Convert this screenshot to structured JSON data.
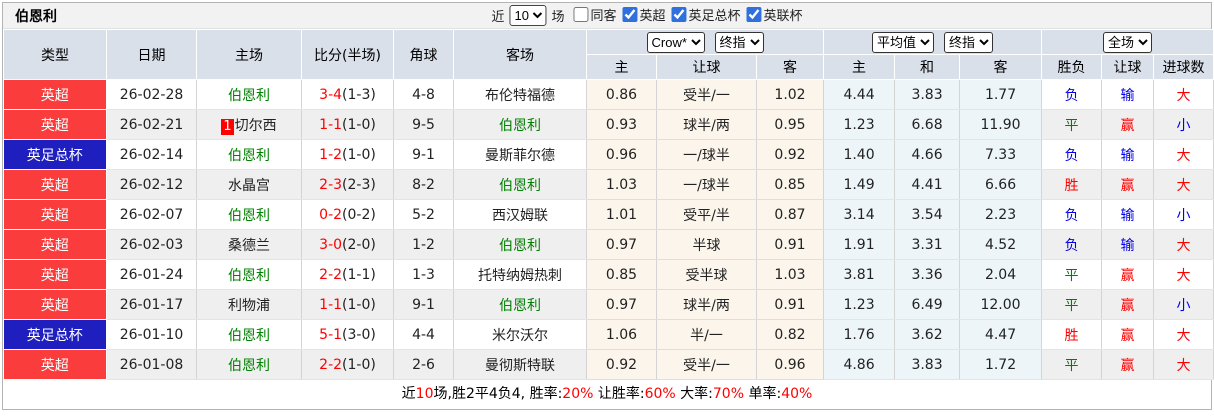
{
  "header": {
    "title": "伯恩利",
    "controls": {
      "near_label": "近",
      "matches_select": "10",
      "matches_label": "场",
      "checkboxes": [
        {
          "label": "同客",
          "checked": false
        },
        {
          "label": "英超",
          "checked": true
        },
        {
          "label": "英足总杯",
          "checked": true
        },
        {
          "label": "英联杯",
          "checked": true
        }
      ]
    }
  },
  "table": {
    "columns": [
      "类型",
      "日期",
      "主场",
      "比分(半场)",
      "角球",
      "客场"
    ],
    "dropdowns": {
      "odds_company": "Crow*",
      "odds_stage": "终指",
      "avg_type": "平均值",
      "avg_stage": "终指",
      "scope": "全场"
    },
    "sub_columns": [
      "主",
      "让球",
      "客",
      "主",
      "和",
      "客",
      "胜负",
      "让球",
      "进球数"
    ],
    "rows": [
      {
        "league": "英超",
        "league_color": "red",
        "date": "26-02-28",
        "home": "伯恩利",
        "home_self": true,
        "home_rank": "",
        "score": "3-4",
        "half": "(1-3)",
        "corner": "4-8",
        "away": "布伦特福德",
        "away_self": false,
        "odds": [
          "0.86",
          "受半/一",
          "1.02"
        ],
        "avg": [
          "4.44",
          "3.83",
          "1.77"
        ],
        "results": [
          "负",
          "输",
          "大"
        ]
      },
      {
        "league": "英超",
        "league_color": "red",
        "date": "26-02-21",
        "home": "切尔西",
        "home_self": false,
        "home_rank": "1",
        "score": "1-1",
        "half": "(1-0)",
        "corner": "9-5",
        "away": "伯恩利",
        "away_self": true,
        "odds": [
          "0.93",
          "球半/两",
          "0.95"
        ],
        "avg": [
          "1.23",
          "6.68",
          "11.90"
        ],
        "results": [
          "平",
          "赢",
          "小"
        ]
      },
      {
        "league": "英足总杯",
        "league_color": "blue",
        "date": "26-02-14",
        "home": "伯恩利",
        "home_self": true,
        "home_rank": "",
        "score": "1-2",
        "half": "(1-0)",
        "corner": "9-1",
        "away": "曼斯菲尔德",
        "away_self": false,
        "odds": [
          "0.96",
          "一/球半",
          "0.92"
        ],
        "avg": [
          "1.40",
          "4.66",
          "7.33"
        ],
        "results": [
          "负",
          "输",
          "大"
        ]
      },
      {
        "league": "英超",
        "league_color": "red",
        "date": "26-02-12",
        "home": "水晶宫",
        "home_self": false,
        "home_rank": "",
        "score": "2-3",
        "half": "(2-3)",
        "corner": "8-2",
        "away": "伯恩利",
        "away_self": true,
        "odds": [
          "1.03",
          "一/球半",
          "0.85"
        ],
        "avg": [
          "1.49",
          "4.41",
          "6.66"
        ],
        "results": [
          "胜",
          "赢",
          "大"
        ]
      },
      {
        "league": "英超",
        "league_color": "red",
        "date": "26-02-07",
        "home": "伯恩利",
        "home_self": true,
        "home_rank": "",
        "score": "0-2",
        "half": "(0-2)",
        "corner": "5-2",
        "away": "西汉姆联",
        "away_self": false,
        "odds": [
          "1.01",
          "受平/半",
          "0.87"
        ],
        "avg": [
          "3.14",
          "3.54",
          "2.23"
        ],
        "results": [
          "负",
          "输",
          "小"
        ]
      },
      {
        "league": "英超",
        "league_color": "red",
        "date": "26-02-03",
        "home": "桑德兰",
        "home_self": false,
        "home_rank": "",
        "score": "3-0",
        "half": "(2-0)",
        "corner": "1-2",
        "away": "伯恩利",
        "away_self": true,
        "odds": [
          "0.97",
          "半球",
          "0.91"
        ],
        "avg": [
          "1.91",
          "3.31",
          "4.52"
        ],
        "results": [
          "负",
          "输",
          "大"
        ]
      },
      {
        "league": "英超",
        "league_color": "red",
        "date": "26-01-24",
        "home": "伯恩利",
        "home_self": true,
        "home_rank": "",
        "score": "2-2",
        "half": "(1-1)",
        "corner": "1-3",
        "away": "托特纳姆热刺",
        "away_self": false,
        "odds": [
          "0.85",
          "受半球",
          "1.03"
        ],
        "avg": [
          "3.81",
          "3.36",
          "2.04"
        ],
        "results": [
          "平",
          "赢",
          "大"
        ]
      },
      {
        "league": "英超",
        "league_color": "red",
        "date": "26-01-17",
        "home": "利物浦",
        "home_self": false,
        "home_rank": "",
        "score": "1-1",
        "half": "(1-0)",
        "corner": "9-1",
        "away": "伯恩利",
        "away_self": true,
        "odds": [
          "0.97",
          "球半/两",
          "0.91"
        ],
        "avg": [
          "1.23",
          "6.49",
          "12.00"
        ],
        "results": [
          "平",
          "赢",
          "小"
        ]
      },
      {
        "league": "英足总杯",
        "league_color": "blue",
        "date": "26-01-10",
        "home": "伯恩利",
        "home_self": true,
        "home_rank": "",
        "score": "5-1",
        "half": "(3-0)",
        "corner": "4-4",
        "away": "米尔沃尔",
        "away_self": false,
        "odds": [
          "1.06",
          "半/一",
          "0.82"
        ],
        "avg": [
          "1.76",
          "3.62",
          "4.47"
        ],
        "results": [
          "胜",
          "赢",
          "大"
        ]
      },
      {
        "league": "英超",
        "league_color": "red",
        "date": "26-01-08",
        "home": "伯恩利",
        "home_self": true,
        "home_rank": "",
        "score": "2-2",
        "half": "(1-0)",
        "corner": "2-6",
        "away": "曼彻斯特联",
        "away_self": false,
        "odds": [
          "0.92",
          "受半/一",
          "0.96"
        ],
        "avg": [
          "4.86",
          "3.83",
          "1.72"
        ],
        "results": [
          "平",
          "赢",
          "大"
        ]
      }
    ]
  },
  "footer": {
    "segments": [
      {
        "text": "近",
        "red": false
      },
      {
        "text": "10",
        "red": true
      },
      {
        "text": "场,胜2平4负4, 胜率:",
        "red": false
      },
      {
        "text": "20%",
        "red": true
      },
      {
        "text": " 让胜率:",
        "red": false
      },
      {
        "text": "60%",
        "red": true
      },
      {
        "text": " 大率:",
        "red": false
      },
      {
        "text": "70%",
        "red": true
      },
      {
        "text": " 单率:",
        "red": false
      },
      {
        "text": "40%",
        "red": true
      }
    ]
  },
  "colors": {
    "league_red": "#fa3c3c",
    "league_blue": "#1f1fc0",
    "self_team_green": "#008000",
    "score_red": "#ff0000",
    "win_red": "#ff0000",
    "draw_green": "#008000",
    "lose_blue": "#0000f0",
    "header_bg": "#dae0ea",
    "odds_bg": "#fbf5ec",
    "avg_bg": "#edf5f9",
    "alt_row_bg": "#efefef"
  }
}
